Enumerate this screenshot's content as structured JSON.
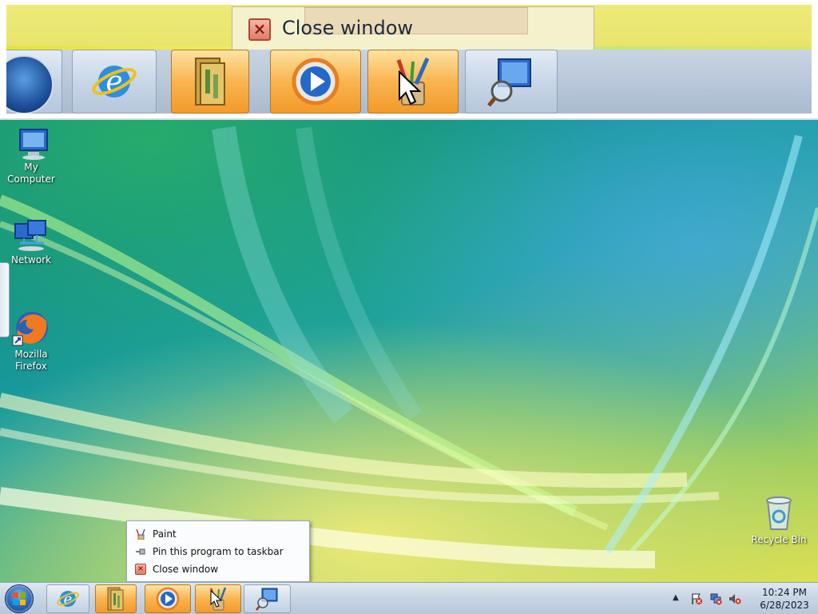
{
  "magnifier": {
    "tooltip_action": "Close window"
  },
  "desktop": {
    "icons": [
      {
        "label": "My Computer"
      },
      {
        "label": "Network"
      },
      {
        "label": "Mozilla Firefox"
      },
      {
        "label": "Recycle Bin"
      }
    ]
  },
  "jump_list": {
    "items": [
      {
        "label": "Paint",
        "icon": "paint-icon"
      },
      {
        "label": "Pin this program to taskbar",
        "icon": "pin-icon"
      },
      {
        "label": "Close window",
        "icon": "close-icon"
      }
    ]
  },
  "taskbar": {
    "buttons": [
      {
        "name": "internet-explorer",
        "icon": "ie-icon",
        "active": false
      },
      {
        "name": "file-explorer",
        "icon": "folder-icon",
        "active": true
      },
      {
        "name": "media-player",
        "icon": "media-player-icon",
        "active": true
      },
      {
        "name": "paint",
        "icon": "paint-icon",
        "active": true
      },
      {
        "name": "magnifier",
        "icon": "magnifier-icon",
        "active": false
      }
    ],
    "clock": {
      "time": "10:24 PM",
      "date": "6/28/2023"
    }
  },
  "colors": {
    "active_button": "#f9b450",
    "taskbar": "#c9d6e4",
    "close_red": "#e07d68"
  }
}
